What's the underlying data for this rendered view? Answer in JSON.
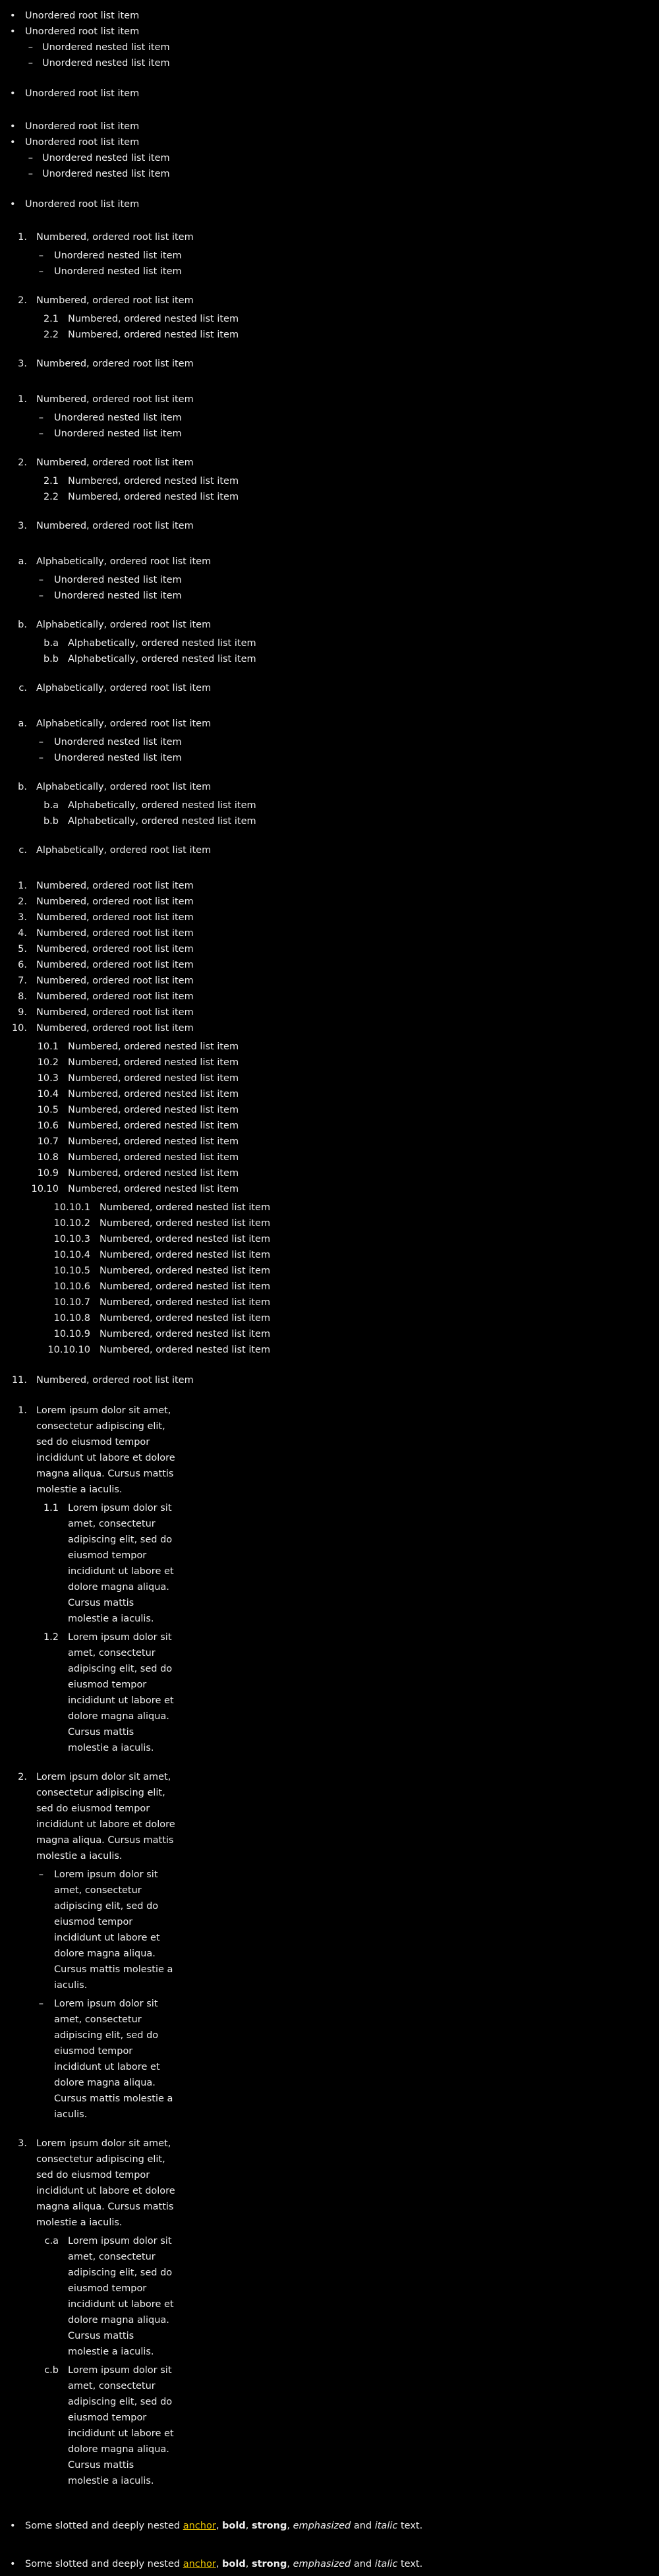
{
  "bullet_lists": [
    {
      "items": [
        {
          "text": "Unordered root list item"
        },
        {
          "text": "Unordered root list item",
          "children": [
            "Unordered nested list item",
            "Unordered nested list item"
          ]
        },
        {
          "text": "Unordered root list item"
        }
      ]
    },
    {
      "items": [
        {
          "text": "Unordered root list item"
        },
        {
          "text": "Unordered root list item",
          "children": [
            "Unordered nested list item",
            "Unordered nested list item"
          ]
        },
        {
          "text": "Unordered root list item"
        }
      ]
    }
  ],
  "ordered_lists": [
    {
      "items": [
        {
          "marker": "1.",
          "text": "Numbered, ordered root list item",
          "child_type": "dash",
          "children": [
            {
              "marker": "–",
              "text": "Unordered nested list item"
            },
            {
              "marker": "–",
              "text": "Unordered nested list item"
            }
          ]
        },
        {
          "marker": "2.",
          "text": "Numbered, ordered root list item",
          "child_type": "num",
          "children": [
            {
              "marker": "2.1",
              "text": "Numbered, ordered nested list item"
            },
            {
              "marker": "2.2",
              "text": "Numbered, ordered nested list item"
            }
          ]
        },
        {
          "marker": "3.",
          "text": "Numbered, ordered root list item"
        }
      ]
    },
    {
      "items": [
        {
          "marker": "1.",
          "text": "Numbered, ordered root list item",
          "child_type": "dash",
          "children": [
            {
              "marker": "–",
              "text": "Unordered nested list item"
            },
            {
              "marker": "–",
              "text": "Unordered nested list item"
            }
          ]
        },
        {
          "marker": "2.",
          "text": "Numbered, ordered root list item",
          "child_type": "num",
          "children": [
            {
              "marker": "2.1",
              "text": "Numbered, ordered nested list item"
            },
            {
              "marker": "2.2",
              "text": "Numbered, ordered nested list item"
            }
          ]
        },
        {
          "marker": "3.",
          "text": "Numbered, ordered root list item"
        }
      ]
    },
    {
      "items": [
        {
          "marker": "a.",
          "text": "Alphabetically, ordered root list item",
          "child_type": "dash",
          "children": [
            {
              "marker": "–",
              "text": "Unordered nested list item"
            },
            {
              "marker": "–",
              "text": "Unordered nested list item"
            }
          ]
        },
        {
          "marker": "b.",
          "text": "Alphabetically, ordered root list item",
          "child_type": "num",
          "children": [
            {
              "marker": "b.a",
              "text": "Alphabetically, ordered nested list item"
            },
            {
              "marker": "b.b",
              "text": "Alphabetically, ordered nested list item"
            }
          ]
        },
        {
          "marker": "c.",
          "text": "Alphabetically, ordered root list item"
        }
      ]
    },
    {
      "items": [
        {
          "marker": "a.",
          "text": "Alphabetically, ordered root list item",
          "child_type": "dash",
          "children": [
            {
              "marker": "–",
              "text": "Unordered nested list item"
            },
            {
              "marker": "–",
              "text": "Unordered nested list item"
            }
          ]
        },
        {
          "marker": "b.",
          "text": "Alphabetically, ordered root list item",
          "child_type": "num",
          "children": [
            {
              "marker": "b.a",
              "text": "Alphabetically, ordered nested list item"
            },
            {
              "marker": "b.b",
              "text": "Alphabetically, ordered nested list item"
            }
          ]
        },
        {
          "marker": "c.",
          "text": "Alphabetically, ordered root list item"
        }
      ]
    }
  ],
  "long_list": {
    "root_text": "Numbered, ordered root list item",
    "nested_text": "Numbered, ordered nested list item",
    "root_markers": [
      "1.",
      "2.",
      "3.",
      "4.",
      "5.",
      "6.",
      "7.",
      "8.",
      "9.",
      "10."
    ],
    "level2_markers": [
      "10.1",
      "10.2",
      "10.3",
      "10.4",
      "10.5",
      "10.6",
      "10.7",
      "10.8",
      "10.9",
      "10.10"
    ],
    "level3_markers": [
      "10.10.1",
      "10.10.2",
      "10.10.3",
      "10.10.4",
      "10.10.5",
      "10.10.6",
      "10.10.7",
      "10.10.8",
      "10.10.9",
      "10.10.10"
    ],
    "last_marker": "11."
  },
  "lorem_list": {
    "root_lines": [
      "Lorem ipsum dolor sit amet,",
      "consectetur adipiscing elit,",
      "sed do eiusmod tempor",
      "incididunt ut labore et dolore",
      "magna aliqua. Cursus mattis",
      "molestie a iaculis."
    ],
    "nested_lines_num": [
      "Lorem ipsum dolor sit",
      "amet, consectetur",
      "adipiscing elit, sed do",
      "eiusmod tempor",
      "incididunt ut labore et",
      "dolore magna aliqua.",
      "Cursus mattis",
      "molestie a iaculis."
    ],
    "nested_lines_dash": [
      "Lorem ipsum dolor sit",
      "amet, consectetur",
      "adipiscing elit, sed do",
      "eiusmod tempor",
      "incididunt ut labore et",
      "dolore magna aliqua.",
      "Cursus mattis molestie a",
      "iaculis."
    ],
    "items": [
      {
        "marker": "1.",
        "child_type": "num",
        "child_markers": [
          "1.1",
          "1.2"
        ]
      },
      {
        "marker": "2.",
        "child_type": "dash",
        "child_markers": [
          "–",
          "–"
        ]
      },
      {
        "marker": "3.",
        "child_type": "num",
        "child_markers": [
          "c.a",
          "c.b"
        ]
      }
    ]
  },
  "slotted": {
    "prefix": "Some slotted and deeply nested",
    "anchor": "anchor",
    "sep1": ",",
    "bold": "bold",
    "sep2": ",",
    "strong": "strong",
    "sep3": ",",
    "emphasized": "emphasized",
    "and": "and",
    "italic": "italic",
    "suffix": "text.",
    "count": 2
  },
  "colors": {
    "background": "#000000",
    "text": "#ededed",
    "anchor": "#e9c300"
  }
}
